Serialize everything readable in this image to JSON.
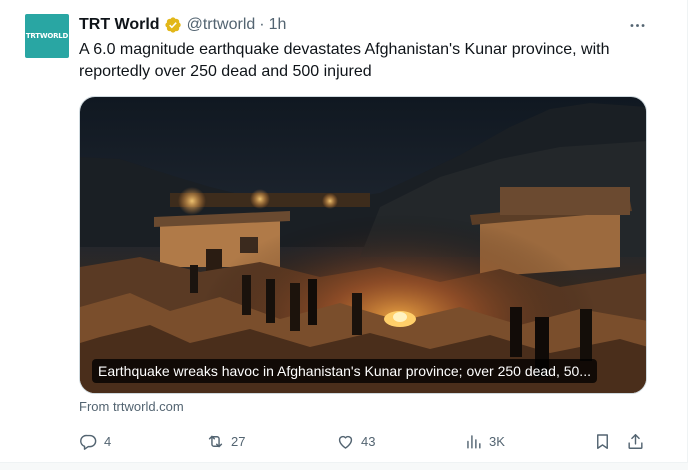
{
  "account": {
    "avatar_text": "TRTWORLD",
    "name": "TRT World",
    "handle": "@trtworld",
    "separator": "·",
    "time": "1h"
  },
  "tweet": {
    "text": "A 6.0 magnitude earthquake devastates Afghanistan's Kunar province, with reportedly over 250 dead and 500 injured"
  },
  "card": {
    "caption": "Earthquake wreaks havoc in Afghanistan's Kunar province; over 250 dead, 50...",
    "source": "From trtworld.com"
  },
  "actions": {
    "replies": "4",
    "reposts": "27",
    "likes": "43",
    "views": "3K"
  },
  "colors": {
    "accent": "#1d9bf0",
    "verified_gold": "#e2b719",
    "text_secondary": "#536471",
    "avatar_bg": "#29a6a3"
  },
  "icons": {
    "more": "more-horizontal-icon",
    "reply": "reply-icon",
    "repost": "repost-icon",
    "like": "heart-icon",
    "views": "views-icon",
    "bookmark": "bookmark-icon",
    "share": "share-icon"
  }
}
